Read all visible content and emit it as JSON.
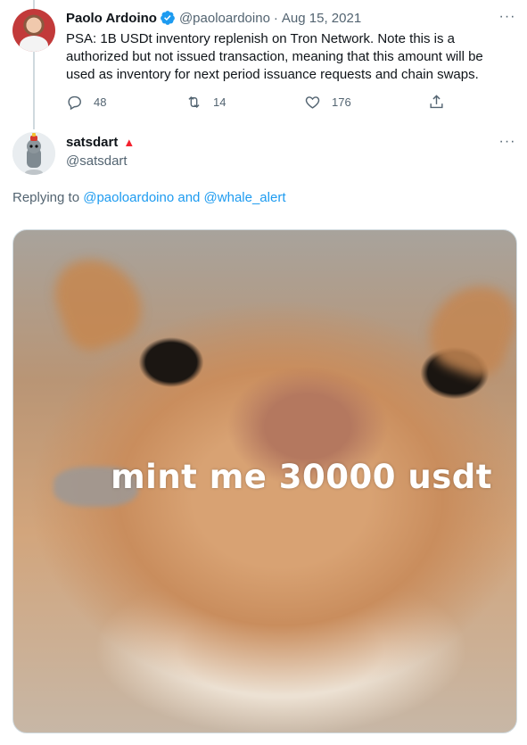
{
  "colors": {
    "link": "#1d9bf0",
    "secondary_text": "#536471",
    "verified": "#1d9bf0",
    "flag": "#f4212e"
  },
  "tweet1": {
    "name": "Paolo Ardoino",
    "handle": "@paoloardoino",
    "separator": "·",
    "date": "Aug 15, 2021",
    "more": "···",
    "text": "PSA: 1B USDt inventory replenish on Tron Network. Note this is a authorized but not issued transaction, meaning that this amount will be used as inventory for next period issuance requests and chain swaps.",
    "replies": "48",
    "retweets": "14",
    "likes": "176"
  },
  "tweet2": {
    "name": "satsdart",
    "handle": "@satsdart",
    "more": "···",
    "replying_prefix": "Replying to",
    "replying_users": "@paoloardoino and @whale_alert",
    "image_caption": "mint me 30000 usdt"
  }
}
